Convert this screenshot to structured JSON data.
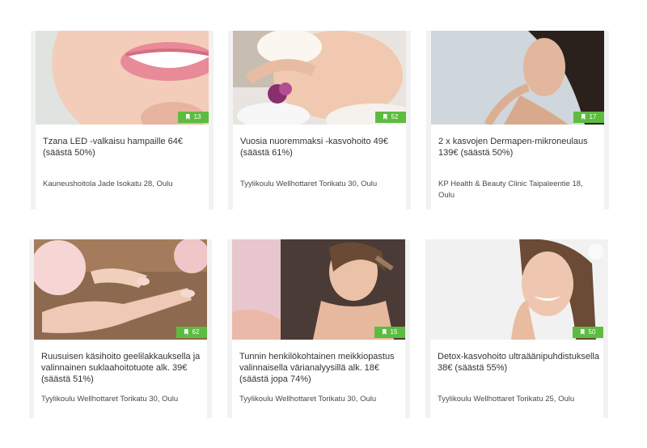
{
  "deals": [
    {
      "title": "Tzana LED -valkaisu hampaille 64€ (säästä 50%)",
      "location": "Kauneushoitola Jade Isokatu 28, Oulu",
      "bookmarks": "13",
      "image": "teeth-smile-photo"
    },
    {
      "title": "Vuosia nuoremmaksi -kasvohoito 49€ (säästä 61%)",
      "location": "Tyylikoulu Wellhottaret Torikatu 30, Oulu",
      "bookmarks": "52",
      "image": "facial-massage-photo"
    },
    {
      "title": "2 x kasvojen Dermapen-mikroneulaus 139€ (säästä 50%)",
      "location": "KP Health & Beauty Clinic Taipaleentie 18, Oulu",
      "bookmarks": "17",
      "image": "woman-profile-photo"
    },
    {
      "title": "Ruusuisen käsihoito geelilakkauksella ja valinnainen suklaahoitotuote alk. 39€ (säästä 51%)",
      "location": "Tyylikoulu Wellhottaret Torikatu 30, Oulu",
      "bookmarks": "62",
      "image": "manicure-hands-photo"
    },
    {
      "title": "Tunnin henkilökohtainen meikkiopastus valinnaisella värianalyysillä alk. 18€ (säästä jopa 74%)",
      "location": "Tyylikoulu Wellhottaret Torikatu 30, Oulu",
      "bookmarks": "15",
      "image": "makeup-brush-photo"
    },
    {
      "title": "Detox-kasvohoito ultraäänipuhdistuksella 38€ (säästä 55%)",
      "location": "Tyylikoulu Wellhottaret Torikatu 25, Oulu",
      "bookmarks": "50",
      "image": "smiling-woman-photo"
    }
  ],
  "colors": {
    "badge": "#5cbc3f",
    "title": "#333333",
    "location": "#4a4a4a"
  }
}
